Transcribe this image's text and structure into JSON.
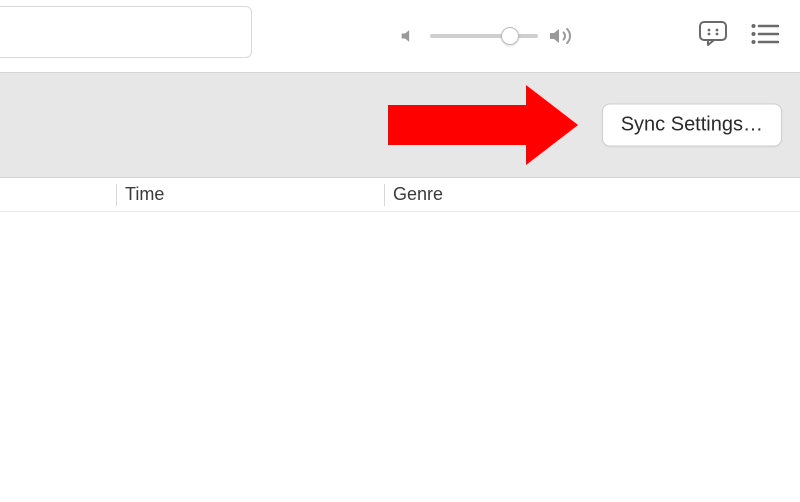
{
  "toolbar": {
    "search_placeholder": "",
    "volume_percent": 74
  },
  "banner": {
    "sync_button_label": "Sync Settings…"
  },
  "columns": {
    "time": "Time",
    "genre": "Genre"
  },
  "annotation": {
    "arrow_color": "#ff0000"
  }
}
